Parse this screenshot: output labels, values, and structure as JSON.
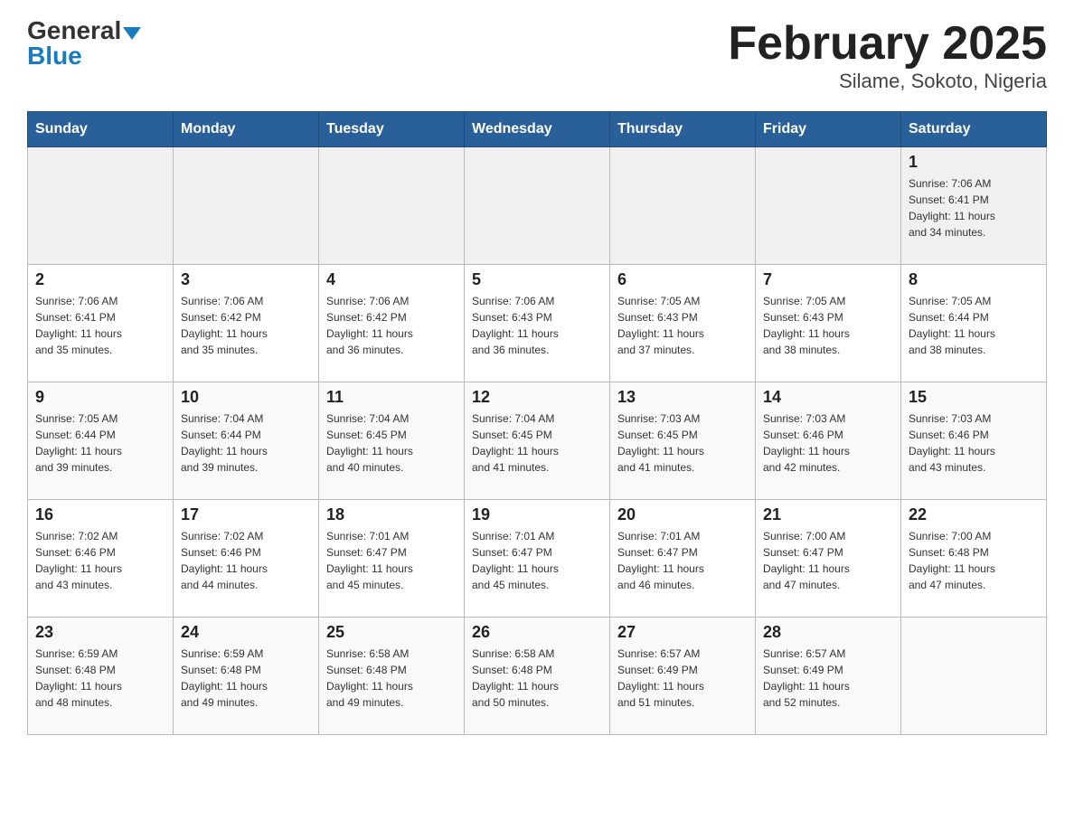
{
  "header": {
    "logo_general": "General",
    "logo_blue": "Blue",
    "title": "February 2025",
    "subtitle": "Silame, Sokoto, Nigeria"
  },
  "days_of_week": [
    "Sunday",
    "Monday",
    "Tuesday",
    "Wednesday",
    "Thursday",
    "Friday",
    "Saturday"
  ],
  "weeks": [
    {
      "days": [
        {
          "number": "",
          "info": ""
        },
        {
          "number": "",
          "info": ""
        },
        {
          "number": "",
          "info": ""
        },
        {
          "number": "",
          "info": ""
        },
        {
          "number": "",
          "info": ""
        },
        {
          "number": "",
          "info": ""
        },
        {
          "number": "1",
          "info": "Sunrise: 7:06 AM\nSunset: 6:41 PM\nDaylight: 11 hours\nand 34 minutes."
        }
      ]
    },
    {
      "days": [
        {
          "number": "2",
          "info": "Sunrise: 7:06 AM\nSunset: 6:41 PM\nDaylight: 11 hours\nand 35 minutes."
        },
        {
          "number": "3",
          "info": "Sunrise: 7:06 AM\nSunset: 6:42 PM\nDaylight: 11 hours\nand 35 minutes."
        },
        {
          "number": "4",
          "info": "Sunrise: 7:06 AM\nSunset: 6:42 PM\nDaylight: 11 hours\nand 36 minutes."
        },
        {
          "number": "5",
          "info": "Sunrise: 7:06 AM\nSunset: 6:43 PM\nDaylight: 11 hours\nand 36 minutes."
        },
        {
          "number": "6",
          "info": "Sunrise: 7:05 AM\nSunset: 6:43 PM\nDaylight: 11 hours\nand 37 minutes."
        },
        {
          "number": "7",
          "info": "Sunrise: 7:05 AM\nSunset: 6:43 PM\nDaylight: 11 hours\nand 38 minutes."
        },
        {
          "number": "8",
          "info": "Sunrise: 7:05 AM\nSunset: 6:44 PM\nDaylight: 11 hours\nand 38 minutes."
        }
      ]
    },
    {
      "days": [
        {
          "number": "9",
          "info": "Sunrise: 7:05 AM\nSunset: 6:44 PM\nDaylight: 11 hours\nand 39 minutes."
        },
        {
          "number": "10",
          "info": "Sunrise: 7:04 AM\nSunset: 6:44 PM\nDaylight: 11 hours\nand 39 minutes."
        },
        {
          "number": "11",
          "info": "Sunrise: 7:04 AM\nSunset: 6:45 PM\nDaylight: 11 hours\nand 40 minutes."
        },
        {
          "number": "12",
          "info": "Sunrise: 7:04 AM\nSunset: 6:45 PM\nDaylight: 11 hours\nand 41 minutes."
        },
        {
          "number": "13",
          "info": "Sunrise: 7:03 AM\nSunset: 6:45 PM\nDaylight: 11 hours\nand 41 minutes."
        },
        {
          "number": "14",
          "info": "Sunrise: 7:03 AM\nSunset: 6:46 PM\nDaylight: 11 hours\nand 42 minutes."
        },
        {
          "number": "15",
          "info": "Sunrise: 7:03 AM\nSunset: 6:46 PM\nDaylight: 11 hours\nand 43 minutes."
        }
      ]
    },
    {
      "days": [
        {
          "number": "16",
          "info": "Sunrise: 7:02 AM\nSunset: 6:46 PM\nDaylight: 11 hours\nand 43 minutes."
        },
        {
          "number": "17",
          "info": "Sunrise: 7:02 AM\nSunset: 6:46 PM\nDaylight: 11 hours\nand 44 minutes."
        },
        {
          "number": "18",
          "info": "Sunrise: 7:01 AM\nSunset: 6:47 PM\nDaylight: 11 hours\nand 45 minutes."
        },
        {
          "number": "19",
          "info": "Sunrise: 7:01 AM\nSunset: 6:47 PM\nDaylight: 11 hours\nand 45 minutes."
        },
        {
          "number": "20",
          "info": "Sunrise: 7:01 AM\nSunset: 6:47 PM\nDaylight: 11 hours\nand 46 minutes."
        },
        {
          "number": "21",
          "info": "Sunrise: 7:00 AM\nSunset: 6:47 PM\nDaylight: 11 hours\nand 47 minutes."
        },
        {
          "number": "22",
          "info": "Sunrise: 7:00 AM\nSunset: 6:48 PM\nDaylight: 11 hours\nand 47 minutes."
        }
      ]
    },
    {
      "days": [
        {
          "number": "23",
          "info": "Sunrise: 6:59 AM\nSunset: 6:48 PM\nDaylight: 11 hours\nand 48 minutes."
        },
        {
          "number": "24",
          "info": "Sunrise: 6:59 AM\nSunset: 6:48 PM\nDaylight: 11 hours\nand 49 minutes."
        },
        {
          "number": "25",
          "info": "Sunrise: 6:58 AM\nSunset: 6:48 PM\nDaylight: 11 hours\nand 49 minutes."
        },
        {
          "number": "26",
          "info": "Sunrise: 6:58 AM\nSunset: 6:48 PM\nDaylight: 11 hours\nand 50 minutes."
        },
        {
          "number": "27",
          "info": "Sunrise: 6:57 AM\nSunset: 6:49 PM\nDaylight: 11 hours\nand 51 minutes."
        },
        {
          "number": "28",
          "info": "Sunrise: 6:57 AM\nSunset: 6:49 PM\nDaylight: 11 hours\nand 52 minutes."
        },
        {
          "number": "",
          "info": ""
        }
      ]
    }
  ]
}
